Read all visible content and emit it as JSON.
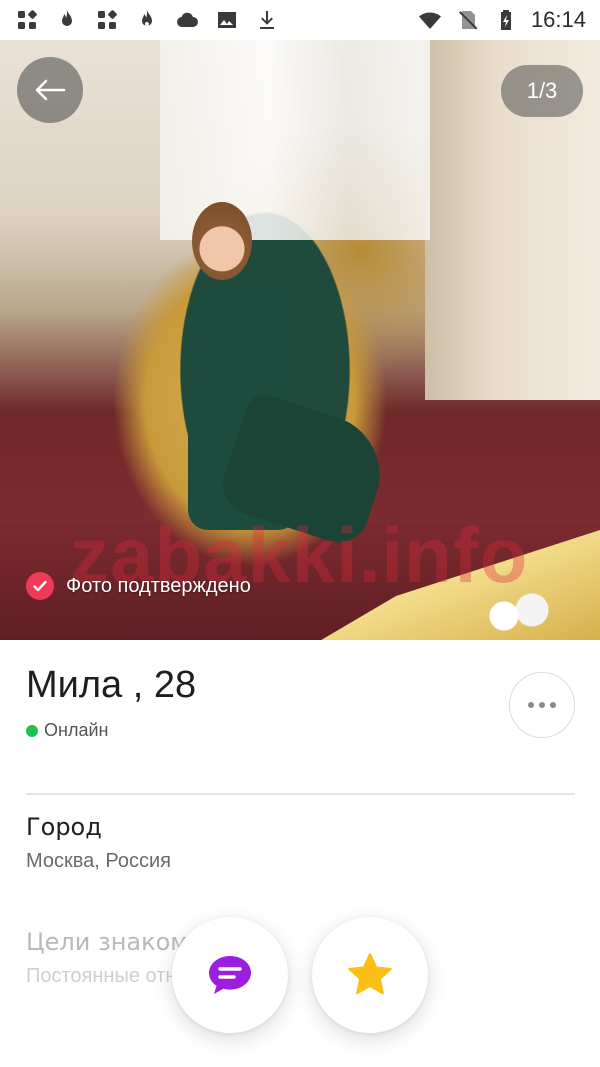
{
  "status_bar": {
    "time": "16:14",
    "left_icons": [
      "apps-icon",
      "flame-icon",
      "apps-icon",
      "flame-outline-icon",
      "cloud-icon",
      "image-icon",
      "download-icon"
    ],
    "right_icons": [
      "wifi-icon",
      "no-sim-icon",
      "battery-charging-icon"
    ]
  },
  "photo": {
    "counter": "1/3",
    "verified_label": "Фото подтверждено",
    "watermark": "zabakki.info"
  },
  "profile": {
    "name": "Мила , 28",
    "status": "Онлайн",
    "city_title": "Город",
    "city_value": "Москва, Россия",
    "goals_title": "Цели знакомства",
    "goals_value": "Постоянные отношения"
  },
  "colors": {
    "online": "#1cc24b",
    "verified": "#ee3a57",
    "chat_accent": "#9b1fe0",
    "star_accent": "#fbbf16"
  }
}
